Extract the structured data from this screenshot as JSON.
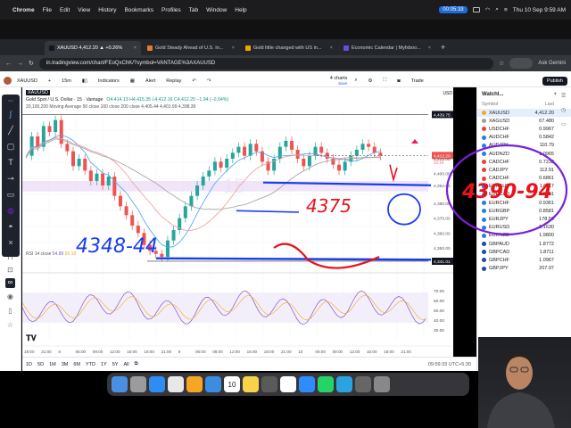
{
  "menubar": {
    "apple": "",
    "items": [
      "Chrome",
      "File",
      "Edit",
      "View",
      "History",
      "Bookmarks",
      "Profiles",
      "Tab",
      "Window",
      "Help"
    ],
    "timer": "00:05:33",
    "datetime": "Thu 10 Sep  9:59 AM"
  },
  "tabs": [
    {
      "label": "XAUUSD 4,412.20 ▲ +0.26%"
    },
    {
      "label": "Gold Steady Ahead of U.S. In..."
    },
    {
      "label": "Gold little changed with US in..."
    },
    {
      "label": "Economic Calendar | Myfxboo..."
    }
  ],
  "address": {
    "url": "in.tradingview.com/chart/FEoQxChK/?symbol=VANTAGE%3AXAUUSD",
    "ask_gemini": "Ask Gemini"
  },
  "tv_toolbar": {
    "symbol": "XAUUSD",
    "interval": "15m",
    "indicators": "Indicators",
    "alert": "Alert",
    "replay": "Replay",
    "layout": "4 charts",
    "layout_sub": "Save",
    "trade": "Trade",
    "publish": "Publish"
  },
  "chart_header": {
    "title": "Gold Spot / U.S. Dollar · 15 · Vantage",
    "ohlc": "O4,414.13 H4,415.35 L4,412.16 C4,412.20 −1.94 (−0.04%)",
    "ma": "20,100,200 Moving Average 50 close 100 close 200 close  4,405.44  4,401.99  4,398.39",
    "watermark": "15",
    "rsi_label": "RSI 14 close",
    "rsi_val1": "54.89",
    "rsi_val2": "59.18"
  },
  "price_axis": {
    "currency": "USD",
    "labels": [
      "4,439.75",
      "4,412.20",
      "4,410.00",
      "4,400.00",
      "4,392.00",
      "4,380.00",
      "4,370.00",
      "4,360.00",
      "4,350.00",
      "4,341.01"
    ],
    "current_price": "4,412.20",
    "current_timer": "12:16",
    "rsi_labels": [
      "70.00",
      "60.00",
      "50.00",
      "40.00",
      "30.00"
    ]
  },
  "time_axis": {
    "labels": [
      "18:00",
      "21:00",
      "8",
      "06:00",
      "09:00",
      "12:00",
      "15:00",
      "18:00",
      "21:00",
      "9",
      "06:00",
      "09:00",
      "12:00",
      "15:00",
      "18:00",
      "21:00",
      "10",
      "06:00",
      "09:00",
      "12:00",
      "15:00",
      "18:00",
      "21:00"
    ]
  },
  "annotations": {
    "left": "4348-44",
    "mid": "4375",
    "right": "4390-94"
  },
  "bottom": {
    "timeframes": [
      "1D",
      "5D",
      "1M",
      "3M",
      "6M",
      "YTD",
      "1Y",
      "5Y",
      "All"
    ],
    "clock": "09:59:33 UTC+5:30"
  },
  "watchlist": {
    "title": "Watchl...",
    "col_symbol": "Symbol",
    "col_last": "Last",
    "rows": [
      {
        "sym": "XAUUSD",
        "val": "4,412.20",
        "color": "#f5a623",
        "sel": true
      },
      {
        "sym": "XAGUSD",
        "val": "67.480",
        "color": "#9aa0a6"
      },
      {
        "sym": "USDCHF",
        "val": "0.9967",
        "color": "#e0433b"
      },
      {
        "sym": "AUDCHF",
        "val": "0.5842",
        "color": "#2a7de1"
      },
      {
        "sym": "AUDJPY",
        "val": "110.79",
        "color": "#2a7de1"
      },
      {
        "sym": "AUDNZD",
        "val": "1.0965",
        "color": "#2a7de1"
      },
      {
        "sym": "CADCHF",
        "val": "0.7232",
        "color": "#e0433b"
      },
      {
        "sym": "CADJPY",
        "val": "112.91",
        "color": "#e0433b"
      },
      {
        "sym": "CADCHF",
        "val": "0.6861",
        "color": "#e0433b"
      },
      {
        "sym": "EURAUD",
        "val": "1.6117",
        "color": "#2a7de1"
      },
      {
        "sym": "EURCAD",
        "val": "1.6251",
        "color": "#2a7de1"
      },
      {
        "sym": "EURCHF",
        "val": "0.9361",
        "color": "#2a7de1"
      },
      {
        "sym": "EURGBP",
        "val": "0.8581",
        "color": "#2a7de1"
      },
      {
        "sym": "EURJPY",
        "val": "178.56",
        "color": "#2a7de1"
      },
      {
        "sym": "EURUSD",
        "val": "1.1630",
        "color": "#2a7de1"
      },
      {
        "sym": "EURNZD",
        "val": "1.9800",
        "color": "#2a7de1"
      },
      {
        "sym": "GBPAUD",
        "val": "1.8772",
        "color": "#1f4b99"
      },
      {
        "sym": "GBPCAD",
        "val": "1.8711",
        "color": "#1f4b99"
      },
      {
        "sym": "GBPCHF",
        "val": "1.0967",
        "color": "#1f4b99"
      },
      {
        "sym": "GBPJPY",
        "val": "207.97",
        "color": "#1f4b99"
      }
    ]
  },
  "dock": {
    "apps": [
      "finder",
      "launchpad",
      "safari",
      "chrome",
      "photos",
      "mail",
      "calendar",
      "notes",
      "calculator",
      "reminders",
      "zoom",
      "whatsapp",
      "telegram",
      "app",
      "trash"
    ],
    "calendar_day": "10"
  },
  "colors": {
    "up": "#26a69a",
    "down": "#ef5350",
    "ink_blue": "#1a3cf0",
    "ink_red": "#e8131b",
    "ink_purple": "#7a1fd8",
    "zone": "#e9d8f7"
  }
}
